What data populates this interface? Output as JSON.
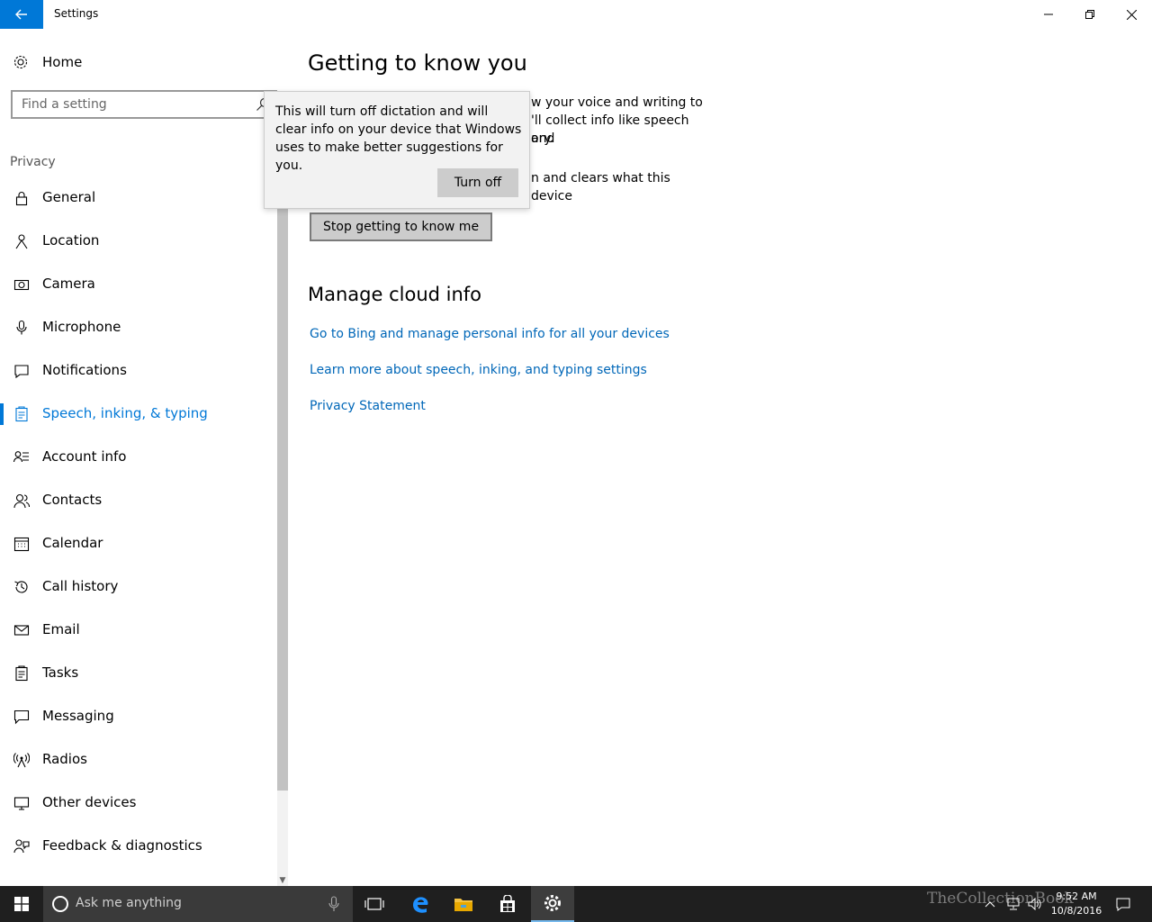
{
  "window": {
    "title": "Settings"
  },
  "sidebar": {
    "home_label": "Home",
    "search_placeholder": "Find a setting",
    "section_label": "Privacy",
    "items": [
      {
        "label": "General",
        "icon": "lock-icon"
      },
      {
        "label": "Location",
        "icon": "location-icon"
      },
      {
        "label": "Camera",
        "icon": "camera-icon"
      },
      {
        "label": "Microphone",
        "icon": "microphone-icon"
      },
      {
        "label": "Notifications",
        "icon": "notifications-icon"
      },
      {
        "label": "Speech, inking, & typing",
        "icon": "speech-icon",
        "active": true
      },
      {
        "label": "Account info",
        "icon": "account-info-icon"
      },
      {
        "label": "Contacts",
        "icon": "contacts-icon"
      },
      {
        "label": "Calendar",
        "icon": "calendar-icon"
      },
      {
        "label": "Call history",
        "icon": "history-icon"
      },
      {
        "label": "Email",
        "icon": "email-icon"
      },
      {
        "label": "Tasks",
        "icon": "tasks-icon"
      },
      {
        "label": "Messaging",
        "icon": "messaging-icon"
      },
      {
        "label": "Radios",
        "icon": "radios-icon"
      },
      {
        "label": "Other devices",
        "icon": "other-devices-icon"
      },
      {
        "label": "Feedback & diagnostics",
        "icon": "feedback-icon"
      }
    ]
  },
  "main": {
    "heading": "Getting to know you",
    "para1_fragment_a": "w your voice and writing to",
    "para1_fragment_b": "'ll collect info like speech and",
    "para1_fragment_c": "ory.",
    "para2_fragment": "n and clears what this device",
    "stop_button_label": "Stop getting to know me",
    "cloud_heading": "Manage cloud info",
    "links": [
      "Go to Bing and manage personal info for all your devices",
      "Learn more about speech, inking, and typing settings",
      "Privacy Statement"
    ]
  },
  "flyout": {
    "message": "This will turn off dictation and will clear info on your device that Windows uses to make better suggestions for you.",
    "button_label": "Turn off"
  },
  "taskbar": {
    "search_placeholder": "Ask me anything",
    "time": "9:52 AM",
    "date": "10/8/2016",
    "watermark": "TheCollectionBook"
  },
  "colors": {
    "accent": "#0078d7",
    "link": "#0067b8",
    "taskbar": "#1f1f1f"
  }
}
